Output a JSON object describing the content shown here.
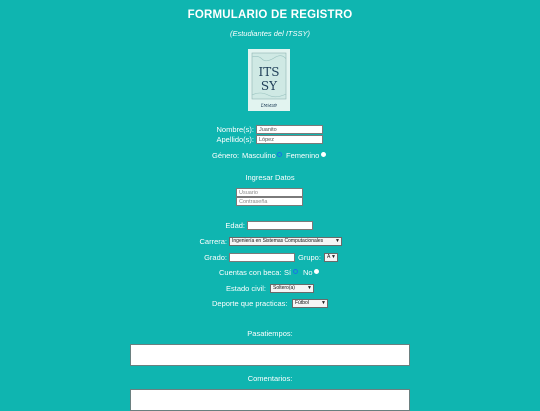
{
  "header": {
    "title": "FORMULARIO DE REGISTRO",
    "subtitle": "(Estudiantes del ITSSY)"
  },
  "logo": {
    "line1": "ITS",
    "line2": "SY",
    "caption": "Ꮭ𝔡𝔞𝔟𝔞𝔯𝔞𝔡"
  },
  "form": {
    "nombre_label": "Nombre(s):",
    "nombre_value": "Juanito",
    "apellido_label": "Apellido(s):",
    "apellido_value": "López",
    "genero_label": "Género:",
    "masculino_label": "Masculino",
    "femenino_label": "Femenino",
    "ingresar_label": "Ingresar Datos",
    "usuario_placeholder": "Usuario",
    "contrasena_placeholder": "Contraseña",
    "edad_label": "Edad:",
    "edad_value": "",
    "carrera_label": "Carrera:",
    "carrera_selected": "Ingeniería en Sistemas Computacionales",
    "grado_label": "Grado:",
    "grado_value": "",
    "grupo_label": "Grupo:",
    "grupo_selected": "A",
    "beca_label": "Cuentas con beca:",
    "beca_si": "Sí",
    "beca_no": "No",
    "estado_label": "Estado civil:",
    "estado_selected": "Soltero(a)",
    "deporte_label": "Deporte que practicas:",
    "deporte_selected": "Fútbol",
    "pasatiempos_label": "Pasatiempos:",
    "comentarios_label": "Comentarios:"
  },
  "colors": {
    "background": "#0fb5b0",
    "text": "#ffffff"
  }
}
